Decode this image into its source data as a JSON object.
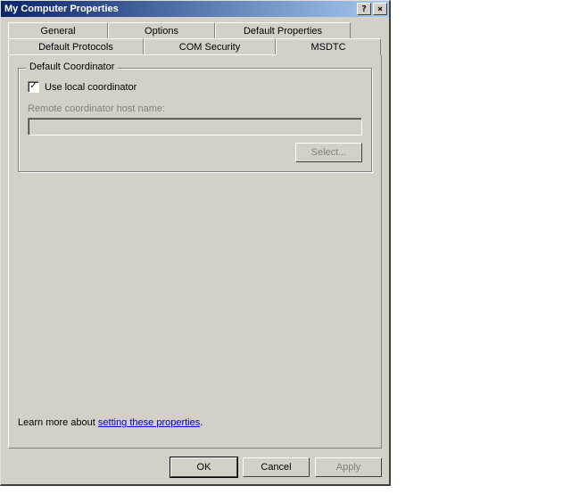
{
  "window": {
    "title": "My Computer Properties"
  },
  "tabs": {
    "row1": [
      "General",
      "Options",
      "Default Properties"
    ],
    "row2": [
      "Default Protocols",
      "COM Security",
      "MSDTC"
    ],
    "active": "MSDTC"
  },
  "group": {
    "title": "Default Coordinator",
    "useLocalLabel": "Use local coordinator",
    "useLocalChecked": true,
    "remoteLabel": "Remote coordinator host name:",
    "remoteValue": "",
    "selectLabel": "Select..."
  },
  "learn": {
    "prefix": "Learn more about ",
    "link": "setting these properties",
    "suffix": "."
  },
  "buttons": {
    "ok": "OK",
    "cancel": "Cancel",
    "apply": "Apply"
  },
  "titlebarIcons": {
    "help": "?",
    "close": "×"
  }
}
